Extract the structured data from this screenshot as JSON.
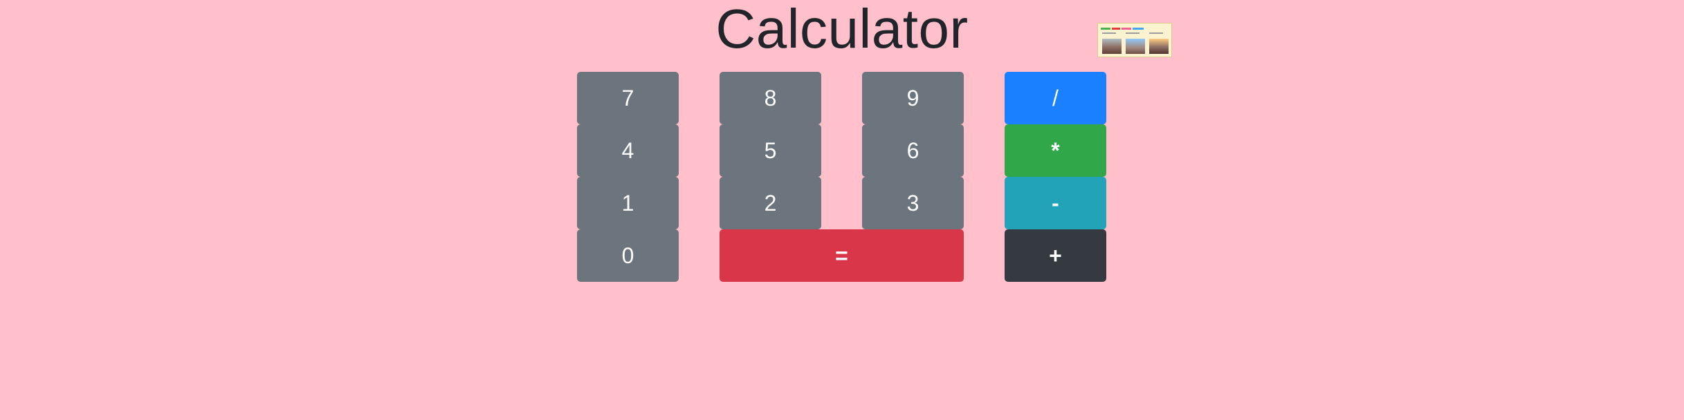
{
  "page": {
    "title": "Calculator"
  },
  "buttons": {
    "seven": "7",
    "eight": "8",
    "nine": "9",
    "divide": "/",
    "four": "4",
    "five": "5",
    "six": "6",
    "multiply": "*",
    "one": "1",
    "two": "2",
    "three": "3",
    "subtract": "-",
    "zero": "0",
    "equals": "=",
    "add": "+"
  },
  "colors": {
    "background": "#ffc0cb",
    "digit": "#6c757d",
    "divide": "#1a80ff",
    "multiply": "#30a84a",
    "subtract": "#22a3b8",
    "equals": "#d9364a",
    "add": "#343a40"
  }
}
